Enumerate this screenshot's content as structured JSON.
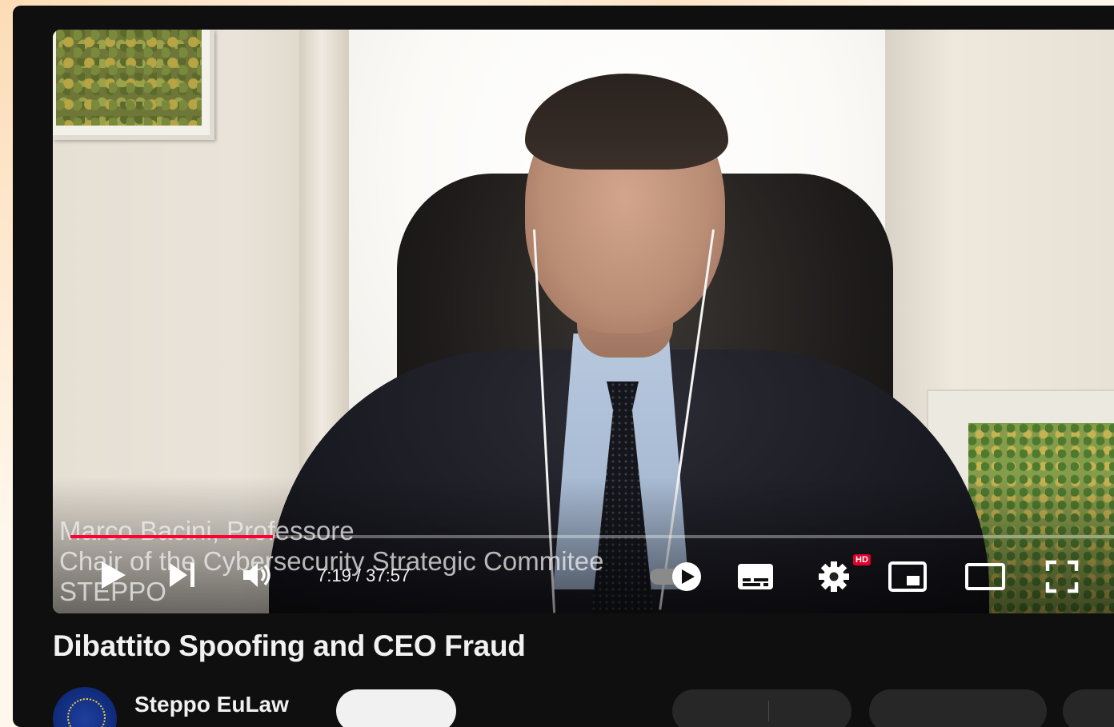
{
  "video": {
    "lower_third": {
      "line1": "Marco Bacini, Professore",
      "line2": "Chair of the Cybersecurity Strategic Commitee",
      "line3": "STEPPO"
    },
    "progress_fraction": 0.194,
    "time_display": "7:19 / 37:57",
    "hd_badge": "HD",
    "title": "Dibattito Spoofing and CEO Fraud"
  },
  "channel": {
    "name": "Steppo EuLaw"
  },
  "colors": {
    "progress": "#ff0033",
    "background": "#0f0f0f",
    "hd_badge": "#e2002d"
  },
  "icons": [
    "play-icon",
    "next-icon",
    "volume-icon",
    "autoplay-toggle-icon",
    "subtitles-icon",
    "settings-icon",
    "miniplayer-icon",
    "theater-mode-icon",
    "fullscreen-icon"
  ]
}
